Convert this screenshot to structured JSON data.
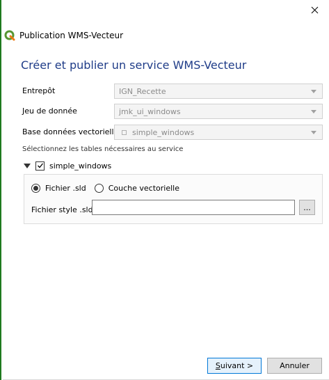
{
  "window": {
    "title": "Publication WMS-Vecteur",
    "heading": "Créer et publier un service WMS-Vecteur"
  },
  "form": {
    "entrepot": {
      "label": "Entrepôt",
      "value": "IGN_Recette"
    },
    "jeu_de_donnee": {
      "label": "Jeu de donnée",
      "value": "jmk_ui_windows"
    },
    "base_donnees": {
      "label": "Base données vectorielle",
      "value": "simple_windows",
      "icon": "database-icon"
    },
    "hint": "Sélectionnez les tables nécessaires au service",
    "tree_item": {
      "label": "simple_windows",
      "checked": true,
      "expanded": true
    },
    "style_source": {
      "option1": "Fichier .sld",
      "option2": "Couche vectorielle",
      "selected": "Fichier .sld"
    },
    "sld_file": {
      "label": "Fichier style .sld",
      "value": "",
      "browse_label": "..."
    }
  },
  "footer": {
    "next_prefix": "",
    "next_underlined": "S",
    "next_rest": "uivant >",
    "cancel_label": "Annuler"
  },
  "colors": {
    "accent": "#1f3c88",
    "window_edge": "#1f7a1f"
  }
}
